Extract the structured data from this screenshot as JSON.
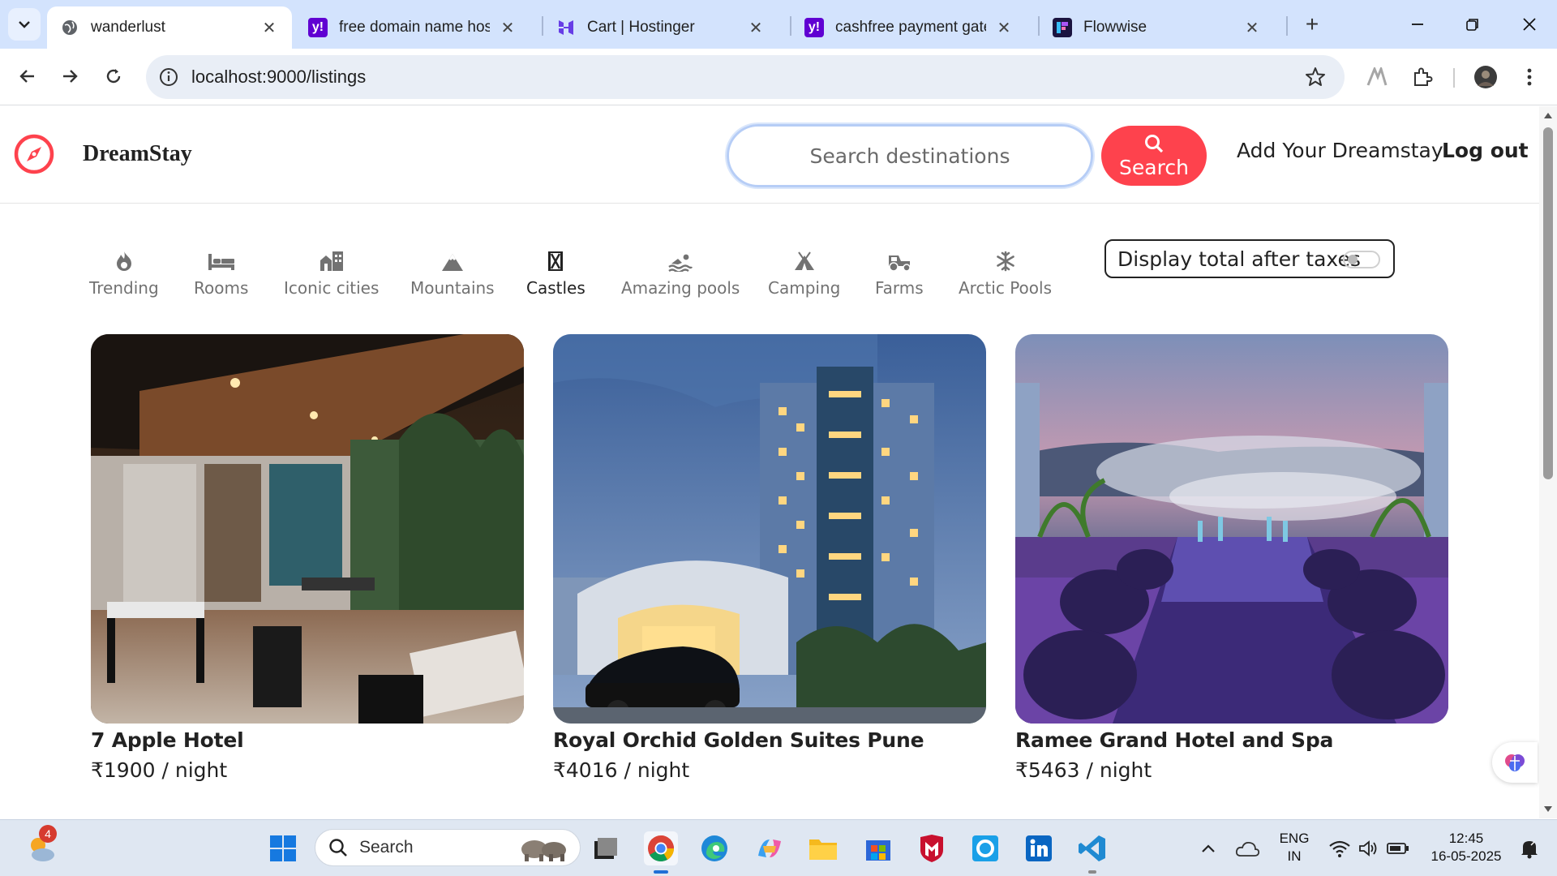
{
  "browser": {
    "tabs": [
      {
        "title": "wanderlust",
        "active": true,
        "icon": "globe-icon"
      },
      {
        "title": "free domain name hostin",
        "active": false,
        "icon": "yahoo-icon"
      },
      {
        "title": "Cart | Hostinger",
        "active": false,
        "icon": "hostinger-icon"
      },
      {
        "title": "cashfree payment gatew",
        "active": false,
        "icon": "yahoo-icon"
      },
      {
        "title": "Flowwise",
        "active": false,
        "icon": "flowwise-icon"
      }
    ],
    "url": "localhost:9000/listings"
  },
  "site": {
    "brand": "DreamStay",
    "search_placeholder": "Search destinations",
    "search_button": "Search",
    "add_link": "Add Your Dreamstay",
    "logout_link": "Log out",
    "accent_color": "#fe424d"
  },
  "filters": [
    {
      "label": "Trending",
      "icon": "fire-icon"
    },
    {
      "label": "Rooms",
      "icon": "bed-icon"
    },
    {
      "label": "Iconic cities",
      "icon": "city-icon"
    },
    {
      "label": "Mountains",
      "icon": "mountain-icon"
    },
    {
      "label": "Castles",
      "icon": "castle-icon",
      "active": true
    },
    {
      "label": "Amazing pools",
      "icon": "swimmer-icon"
    },
    {
      "label": "Camping",
      "icon": "tent-icon"
    },
    {
      "label": "Farms",
      "icon": "tractor-icon"
    },
    {
      "label": "Arctic Pools",
      "icon": "snowflake-icon"
    }
  ],
  "tax_toggle": {
    "label": "Display total after taxes",
    "on": false
  },
  "listings": [
    {
      "name": "7 Apple Hotel",
      "price": "₹1900 / night"
    },
    {
      "name": "Royal Orchid Golden Suites Pune",
      "price": "₹4016 / night"
    },
    {
      "name": "Ramee Grand Hotel and Spa",
      "price": "₹5463 / night"
    }
  ],
  "taskbar": {
    "search_label": "Search",
    "weather_badge": "4",
    "language": "ENG",
    "region": "IN",
    "time": "12:45",
    "date": "16-05-2025"
  }
}
